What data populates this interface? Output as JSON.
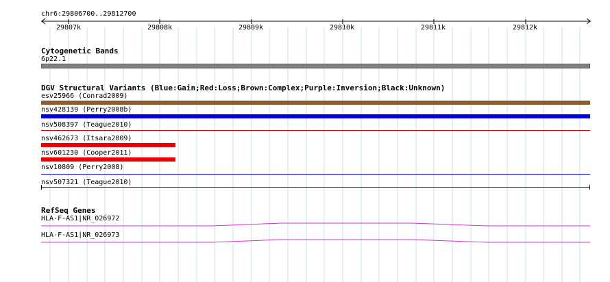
{
  "locus": "chr6:29806700..29812700",
  "ruler": {
    "tick_labels": [
      "29807k",
      "29808k",
      "29809k",
      "29810k",
      "29811k",
      "29812k"
    ]
  },
  "tracks": {
    "cytoband": {
      "title": "Cytogenetic Bands",
      "band_label": "6p22.1",
      "band_color": "#808080"
    },
    "dgv": {
      "title": "DGV Structural Variants (Blue:Gain;Red:Loss;Brown:Complex;Purple:Inversion;Black:Unknown)",
      "variants": [
        {
          "label": "esv25966 (Conrad2009)",
          "color": "#8b5a2b",
          "type": "complex"
        },
        {
          "label": "nsv428139 (Perry2008b)",
          "color": "#0000ee",
          "type": "gain"
        },
        {
          "label": "nsv508397 (Teague2010)",
          "color": "#cc0000",
          "type": "loss"
        },
        {
          "label": "nsv462673 (Itsara2009)",
          "color": "#ee0000",
          "type": "loss"
        },
        {
          "label": "nsv601230 (Cooper2011)",
          "color": "#ee0000",
          "type": "loss"
        },
        {
          "label": "nsv10809 (Perry2008)",
          "color": "#0000cc",
          "type": "gain"
        },
        {
          "label": "nsv507321 (Teague2010)",
          "color": "#0000cc",
          "type": "gain"
        }
      ]
    },
    "refseq": {
      "title": "RefSeq Genes",
      "genes": [
        {
          "label": "HLA-F-AS1|NR_026972",
          "color": "#cc33cc"
        },
        {
          "label": "HLA-F-AS1|NR_026973",
          "color": "#cc33cc"
        }
      ]
    }
  },
  "colors": {
    "grid": "#c8e1f0"
  }
}
